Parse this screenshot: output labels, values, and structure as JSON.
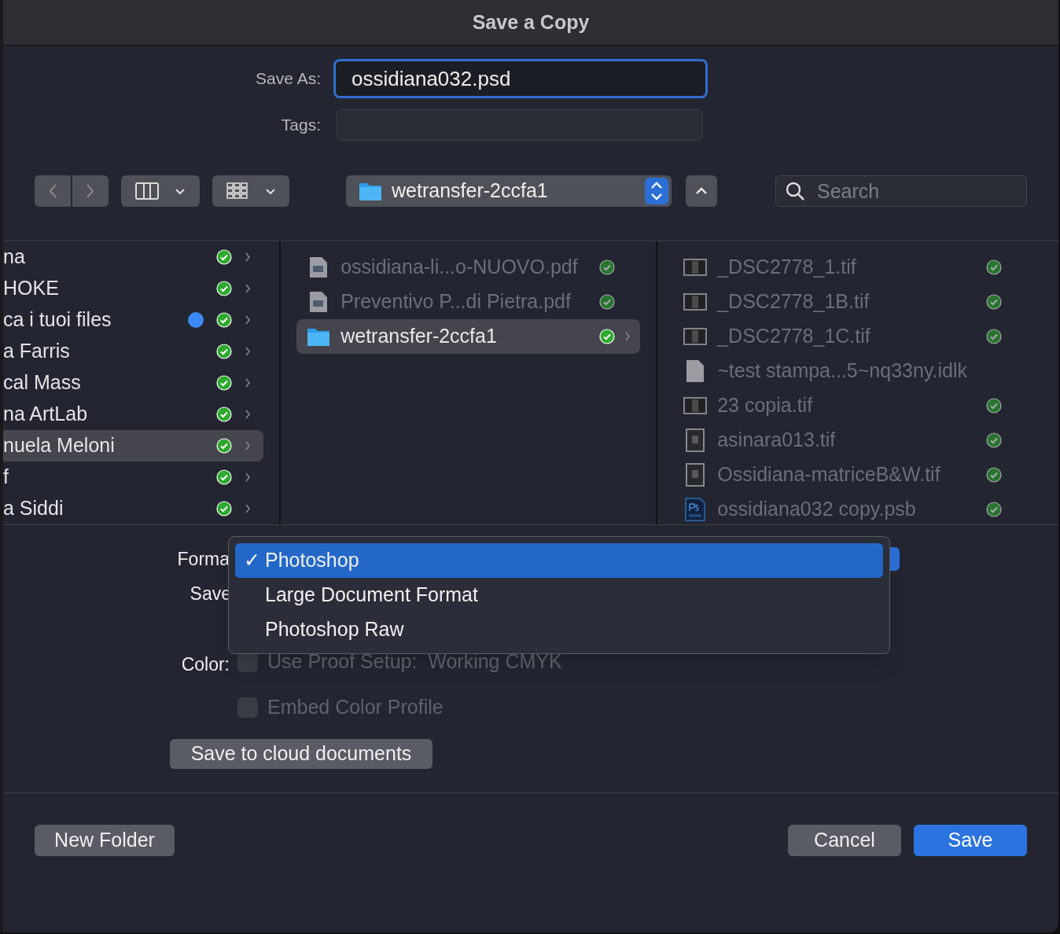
{
  "window": {
    "title": "Save a Copy"
  },
  "save_as": {
    "label": "Save As:",
    "value": "ossidiana032.psd"
  },
  "tags": {
    "label": "Tags:"
  },
  "toolbar": {
    "location": "wetransfer-2ccfa1",
    "search": {
      "placeholder": "Search"
    }
  },
  "sidebar": {
    "items": [
      {
        "label": "na",
        "selected": false,
        "synced": true
      },
      {
        "label": "HOKE",
        "selected": false,
        "synced": true
      },
      {
        "label": "ca i tuoi files",
        "selected": false,
        "synced": true,
        "color": "#3d8af7"
      },
      {
        "label": "a Farris",
        "selected": false,
        "synced": true
      },
      {
        "label": "cal Mass",
        "selected": false,
        "synced": true
      },
      {
        "label": "na ArtLab",
        "selected": false,
        "synced": true
      },
      {
        "label": "nuela Meloni",
        "selected": true,
        "synced": true
      },
      {
        "label": "f",
        "selected": false,
        "synced": true
      },
      {
        "label": "a Siddi",
        "selected": false,
        "synced": true
      }
    ]
  },
  "column_2": {
    "items": [
      {
        "name": "ossidiana-li...o-NUOVO.pdf",
        "kind": "pdf",
        "disabled": true,
        "selected": false,
        "synced": true
      },
      {
        "name": "Preventivo P...di Pietra.pdf",
        "kind": "pdf",
        "disabled": true,
        "selected": false,
        "synced": true
      },
      {
        "name": "wetransfer-2ccfa1",
        "kind": "folder",
        "disabled": false,
        "selected": true,
        "synced": true
      }
    ]
  },
  "column_3": {
    "items": [
      {
        "name": "_DSC2778_1.tif",
        "kind": "image",
        "disabled": true,
        "selected": false,
        "synced": true
      },
      {
        "name": "_DSC2778_1B.tif",
        "kind": "image",
        "disabled": true,
        "selected": false,
        "synced": true
      },
      {
        "name": "_DSC2778_1C.tif",
        "kind": "image",
        "disabled": true,
        "selected": false,
        "synced": true
      },
      {
        "name": "~test stampa...5~nq33ny.idlk",
        "kind": "blank",
        "disabled": true,
        "selected": false,
        "synced": false
      },
      {
        "name": "23 copia.tif",
        "kind": "image",
        "disabled": true,
        "selected": false,
        "synced": true
      },
      {
        "name": "asinara013.tif",
        "kind": "portrait",
        "disabled": true,
        "selected": false,
        "synced": true
      },
      {
        "name": "Ossidiana-matriceB&W.tif",
        "kind": "portrait",
        "disabled": true,
        "selected": false,
        "synced": true
      },
      {
        "name": "ossidiana032 copy.psb",
        "kind": "psb",
        "disabled": true,
        "selected": false,
        "synced": true
      }
    ]
  },
  "options": {
    "format_label": "Forma",
    "save_label": "Save",
    "color_label": "Color:",
    "color_options": [
      {
        "label": "Use Proof Setup:  Working CMYK",
        "checked": false,
        "disabled": true
      },
      {
        "label": "Embed Color Profile",
        "checked": false,
        "disabled": true
      }
    ],
    "cloud_button": "Save to cloud documents"
  },
  "format_menu": {
    "items": [
      {
        "label": "Photoshop",
        "selected": true,
        "mark": "✓"
      },
      {
        "label": "Large Document Format",
        "selected": false
      },
      {
        "label": "Photoshop Raw",
        "selected": false
      }
    ]
  },
  "footer": {
    "new_folder": "New Folder",
    "cancel": "Cancel",
    "save": "Save"
  }
}
